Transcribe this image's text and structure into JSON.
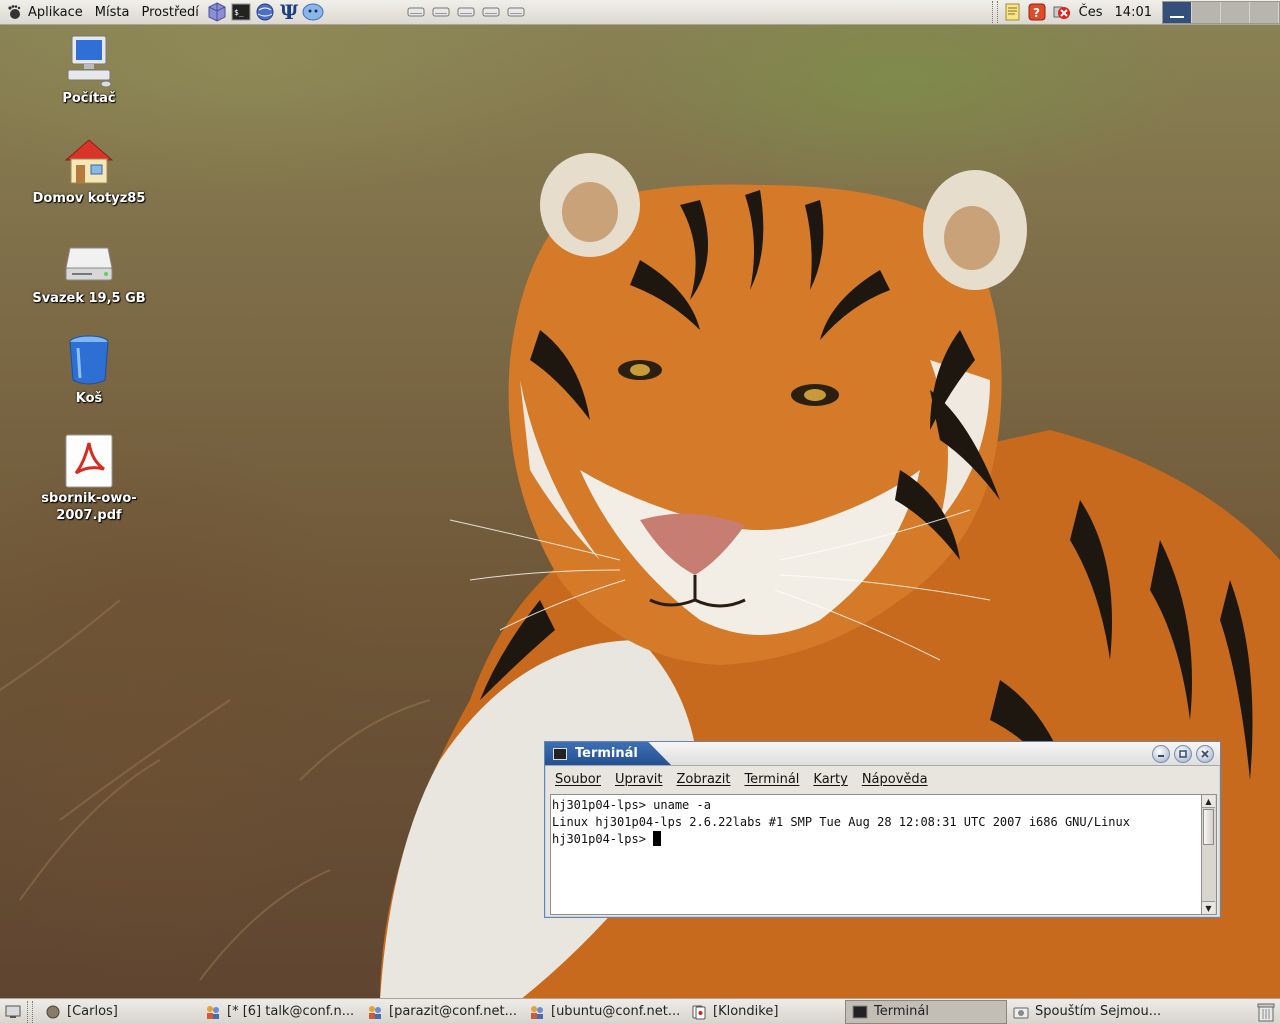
{
  "top_panel": {
    "menus": [
      "Aplikace",
      "Místa",
      "Prostředí"
    ],
    "launchers": [
      "tunderbird-icon",
      "terminal-icon",
      "network-icon",
      "psi-icon",
      "chat-icon"
    ],
    "drives_count_label": "",
    "tray": {
      "language": "Čes",
      "time": "14:01"
    }
  },
  "desktop": {
    "icons": [
      {
        "label": "Počítač",
        "icon": "computer-icon"
      },
      {
        "label": "Domov kotyz85",
        "icon": "home-icon"
      },
      {
        "label": "Svazek 19,5 GB",
        "icon": "drive-icon"
      },
      {
        "label": "Koš",
        "icon": "trash-icon"
      },
      {
        "label": "sbornik-owo-2007.pdf",
        "icon": "pdf-icon"
      }
    ]
  },
  "terminal": {
    "title": "Terminál",
    "menu": [
      "Soubor",
      "Upravit",
      "Zobrazit",
      "Terminál",
      "Karty",
      "Nápověda"
    ],
    "lines": [
      "hj301p04-lps> uname -a",
      "Linux hj301p04-lps 2.6.22labs #1 SMP Tue Aug 28 12:08:31 UTC 2007 i686 GNU/Linux",
      "hj301p04-lps> "
    ]
  },
  "taskbar": {
    "tasks": [
      {
        "label": "[Carlos]",
        "icon": "game-icon",
        "active": false
      },
      {
        "label": "[* [6] talk@conf.n...",
        "icon": "people-icon",
        "active": false
      },
      {
        "label": "[parazit@conf.net...",
        "icon": "people-icon",
        "active": false
      },
      {
        "label": "[ubuntu@conf.net...",
        "icon": "people-icon",
        "active": false
      },
      {
        "label": "[Klondike]",
        "icon": "cards-icon",
        "active": false
      },
      {
        "label": "Terminál",
        "icon": "terminal-icon",
        "active": true
      },
      {
        "label": "Spouštím Sejmou...",
        "icon": "camera-icon",
        "active": false
      }
    ]
  },
  "colors": {
    "titlebar_active": "#23508f",
    "panel": "#dcd8d1",
    "workspace_active": "#34507a"
  }
}
